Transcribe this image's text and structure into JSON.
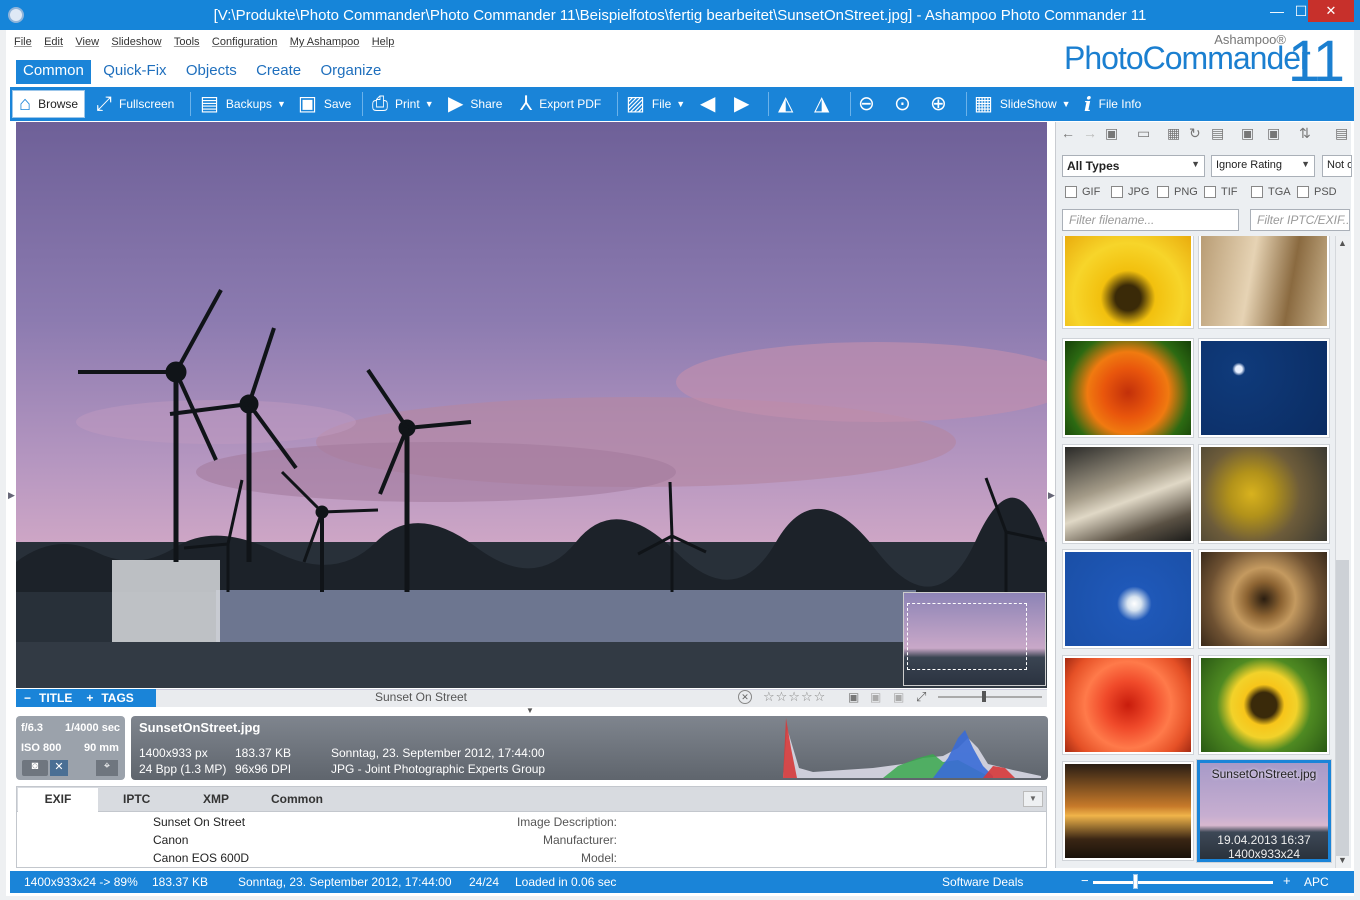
{
  "window": {
    "title": "[V:\\Produkte\\Photo Commander\\Photo Commander 11\\Beispielfotos\\fertig bearbeitet\\SunsetOnStreet.jpg] - Ashampoo Photo Commander 11",
    "minimize": "—",
    "maximize": "☐",
    "close": "✕"
  },
  "menu": [
    "File",
    "Edit",
    "View",
    "Slideshow",
    "Tools",
    "Configuration",
    "My Ashampoo",
    "Help"
  ],
  "logo": {
    "brand": "Ashampoo®",
    "product": "PhotoCommander",
    "version": "11"
  },
  "ribbon_tabs": [
    "Common",
    "Quick-Fix",
    "Objects",
    "Create",
    "Organize"
  ],
  "toolbar": {
    "browse": "Browse",
    "fullscreen": "Fullscreen",
    "backups": "Backups",
    "save": "Save",
    "print": "Print",
    "share": "Share",
    "export_pdf": "Export PDF",
    "file": "File",
    "slideshow": "SlideShow",
    "file_info": "File Info"
  },
  "title_tags": {
    "title": "TITLE",
    "tags": "TAGS",
    "name": "Sunset On Street"
  },
  "exif_badge": {
    "aperture": "f/6.3",
    "shutter": "1/4000 sec",
    "iso": "ISO 800",
    "focal": "90 mm"
  },
  "info": {
    "filename": "SunsetOnStreet.jpg",
    "dimensions": "1400x933 px",
    "size": "183.37 KB",
    "date": "Sonntag, 23. September 2012, 17:44:00",
    "bpp": "24 Bpp (1.3 MP)",
    "dpi": "96x96 DPI",
    "format": "JPG - Joint Photographic Experts Group"
  },
  "meta_tabs": [
    "EXIF",
    "IPTC",
    "XMP",
    "Common"
  ],
  "meta_rows": [
    {
      "label": "Image Description:",
      "value": "Sunset On Street"
    },
    {
      "label": "Manufacturer:",
      "value": "Canon"
    },
    {
      "label": "Model:",
      "value": "Canon EOS 600D"
    }
  ],
  "filters": {
    "types": "All Types",
    "rating": "Ignore Rating",
    "other": "Not o",
    "checkboxes": [
      "GIF",
      "JPG",
      "PNG",
      "TIF",
      "TGA",
      "PSD"
    ],
    "filename_placeholder": "Filter filename...",
    "iptc_placeholder": "Filter IPTC/EXIF..."
  },
  "selected_thumb": {
    "name": "SunsetOnStreet.jpg",
    "date": "19.04.2013 16:37",
    "dims": "1400x933x24"
  },
  "status": {
    "zoom": "1400x933x24 -> 89%",
    "size": "183.37 KB",
    "date": "Sonntag, 23. September 2012, 17:44:00",
    "count": "24/24",
    "loaded": "Loaded in 0.06 sec",
    "deals": "Software Deals",
    "apc": "APC"
  },
  "colors": {
    "accent": "#1a84d8",
    "title_bar": "#1685d9",
    "close": "#c7302b"
  }
}
